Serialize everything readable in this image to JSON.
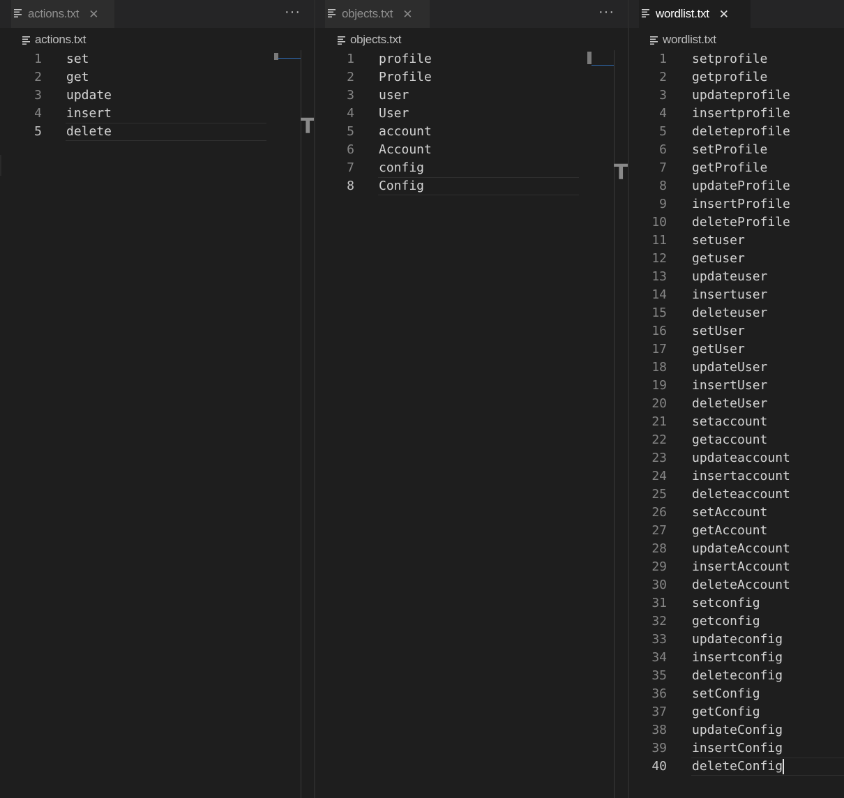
{
  "groups": [
    {
      "tab_label": "actions.txt",
      "breadcrumb": "actions.txt",
      "more_label": "···",
      "current_line": 5,
      "lines": [
        "set",
        "get",
        "update",
        "insert",
        "delete"
      ]
    },
    {
      "tab_label": "objects.txt",
      "breadcrumb": "objects.txt",
      "more_label": "···",
      "current_line": 8,
      "lines": [
        "profile",
        "Profile",
        "user",
        "User",
        "account",
        "Account",
        "config",
        "Config"
      ]
    },
    {
      "tab_label": "wordlist.txt",
      "breadcrumb": "wordlist.txt",
      "current_line": 40,
      "lines": [
        "setprofile",
        "getprofile",
        "updateprofile",
        "insertprofile",
        "deleteprofile",
        "setProfile",
        "getProfile",
        "updateProfile",
        "insertProfile",
        "deleteProfile",
        "setuser",
        "getuser",
        "updateuser",
        "insertuser",
        "deleteuser",
        "setUser",
        "getUser",
        "updateUser",
        "insertUser",
        "deleteUser",
        "setaccount",
        "getaccount",
        "updateaccount",
        "insertaccount",
        "deleteaccount",
        "setAccount",
        "getAccount",
        "updateAccount",
        "insertAccount",
        "deleteAccount",
        "setconfig",
        "getconfig",
        "updateconfig",
        "insertconfig",
        "deleteconfig",
        "setConfig",
        "getConfig",
        "updateConfig",
        "insertConfig",
        "deleteConfig"
      ]
    }
  ],
  "minimap_glyph": "T",
  "tab_close_glyph": "✕",
  "colors": {
    "background": "#1e1e1e",
    "tabbar": "#252526",
    "inactive_tab": "#2d2d2d",
    "line_number": "#858585",
    "text": "#d4d4d4",
    "minimap_accent": "#2f6ab0"
  }
}
